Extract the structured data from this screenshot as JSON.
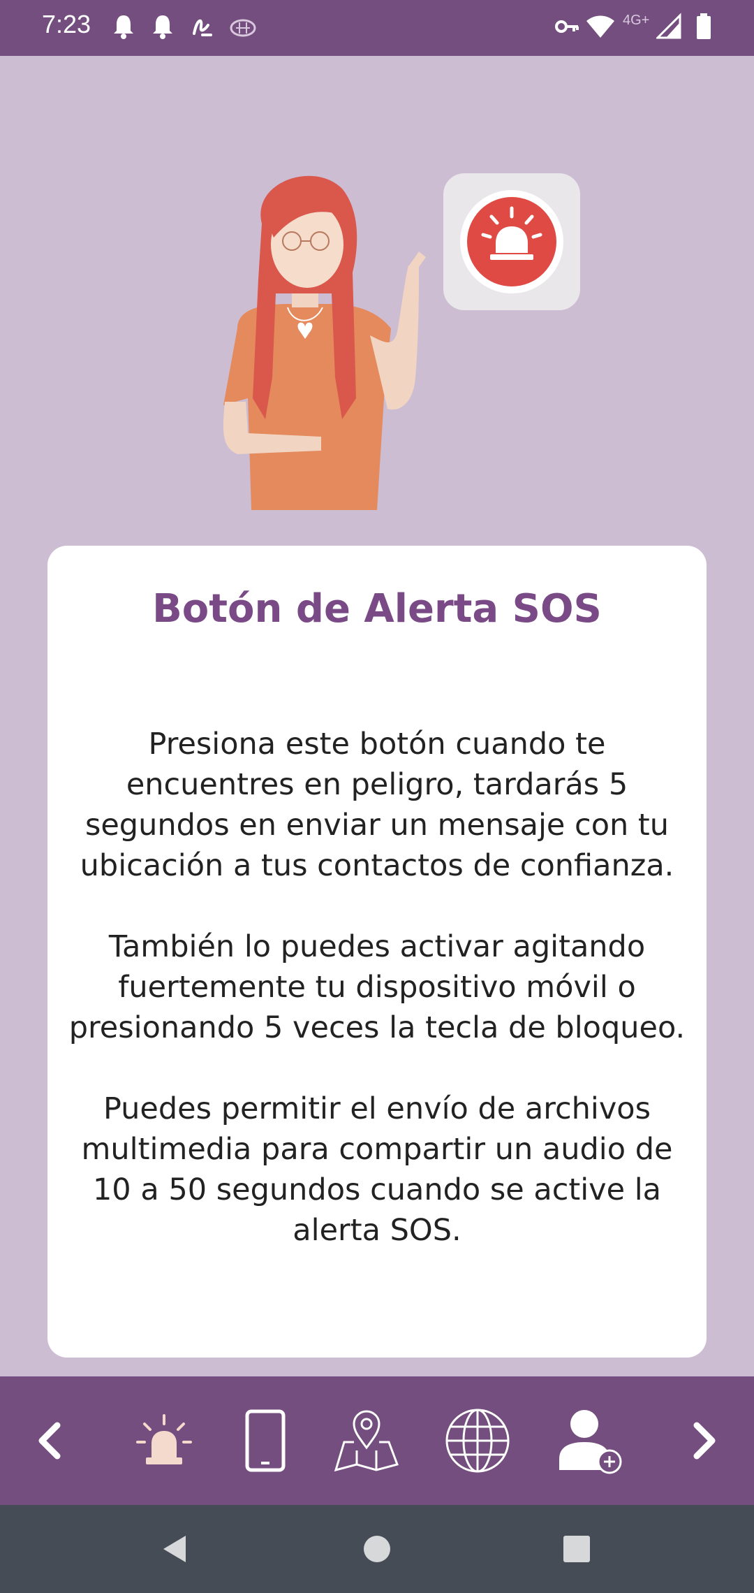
{
  "status_bar": {
    "time": "7:23",
    "network": "4G+",
    "icons": [
      "bell-icon",
      "bell-icon",
      "signature-icon",
      "brain-icon",
      "key-icon",
      "wifi-icon",
      "signal-icon",
      "battery-icon"
    ]
  },
  "card": {
    "title": "Botón de Alerta SOS",
    "paragraph1": "Presiona este botón cuando te encuentres en peligro, tardarás 5 segundos en enviar un mensaje con tu ubicación a tus contactos de confianza.",
    "paragraph2": "También lo puedes activar agitando fuertemente tu dispositivo móvil o presionando 5 veces la tecla de bloqueo.",
    "paragraph3": "Puedes permitir el envío de archivos multimedia para compartir un audio de 10 a 50 segundos cuando se active la alerta SOS."
  },
  "bottom_nav": {
    "items": [
      "chevron-left-icon",
      "alarm-siren-icon",
      "phone-icon",
      "map-pin-icon",
      "globe-icon",
      "add-contact-icon",
      "chevron-right-icon"
    ]
  },
  "colors": {
    "primary": "#744e7e",
    "background": "#ccbdd3",
    "title": "#7a4a86",
    "alert_red": "#e04a45",
    "system_nav": "#464c55"
  }
}
